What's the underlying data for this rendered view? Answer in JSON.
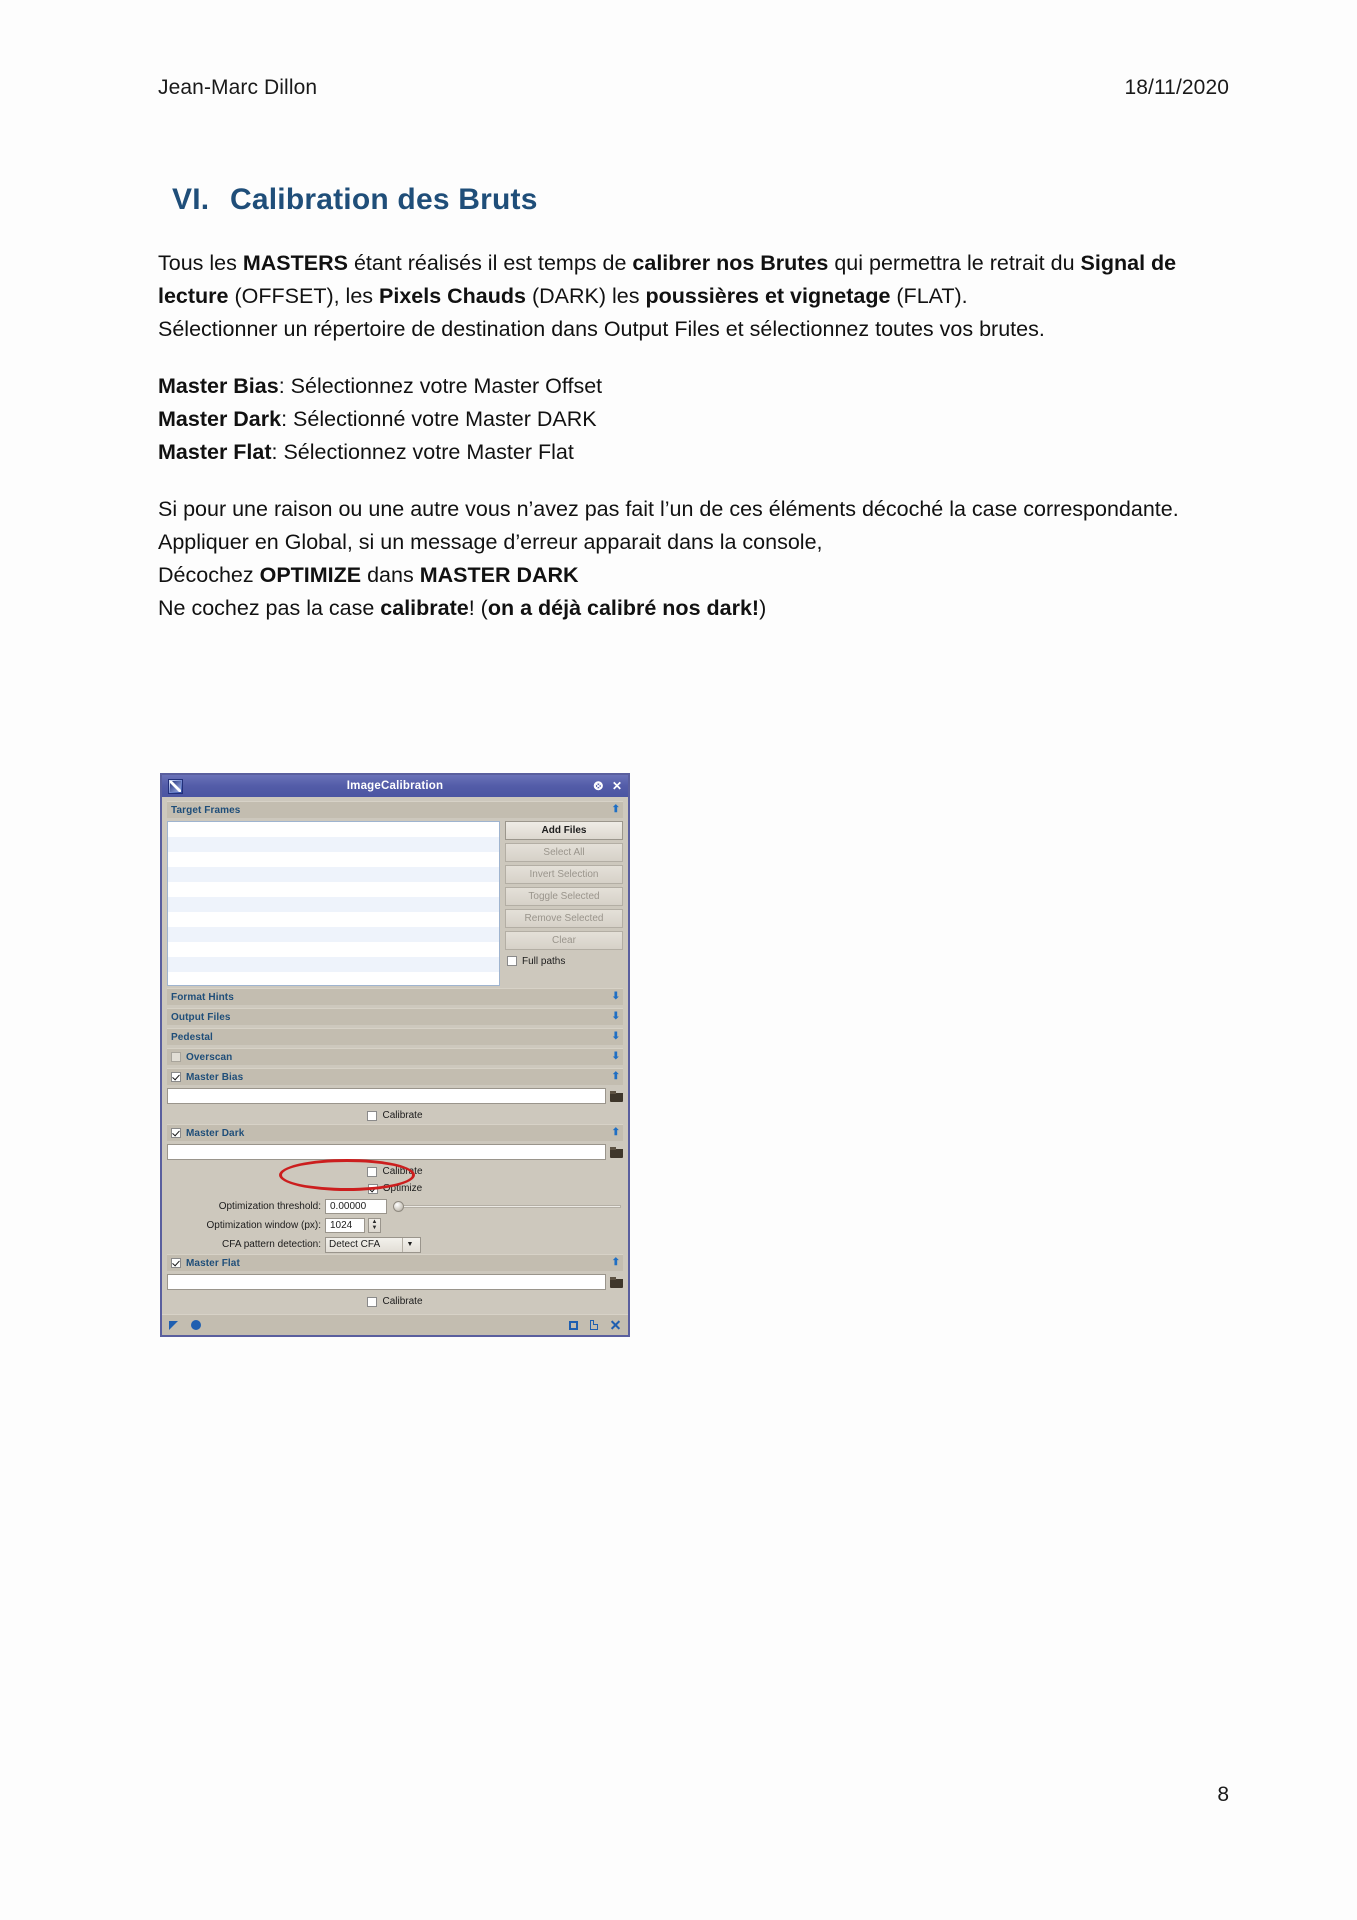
{
  "header": {
    "author": "Jean-Marc Dillon",
    "date": "18/11/2020"
  },
  "heading": {
    "numeral": "VI.",
    "title": "Calibration des Bruts"
  },
  "body": {
    "p1_a": "Tous les ",
    "p1_b1": "MASTERS",
    "p1_b": " étant réalisés il est temps de ",
    "p1_b2": "calibrer nos Brutes",
    "p1_c": " qui permettra le retrait du ",
    "p1_b3": "Signal de lecture",
    "p1_d": " (OFFSET), les ",
    "p1_b4": "Pixels Chauds",
    "p1_e": " (DARK) les ",
    "p1_b5": "poussières et vignetage",
    "p1_f": " (FLAT).",
    "p2": "Sélectionner un répertoire de destination dans Output Files et sélectionnez toutes vos brutes.",
    "m1_b": "Master Bias",
    "m1_t": ": Sélectionnez votre Master Offset",
    "m2_b": "Master Dark",
    "m2_t": ": Sélectionné votre Master DARK",
    "m3_b": "Master Flat",
    "m3_t": ": Sélectionnez votre Master Flat",
    "p3": "Si pour une raison ou une autre vous n’avez pas fait l’un de ces éléments décoché la case correspondante.",
    "p4": "Appliquer en Global, si un message d’erreur apparait dans la console,",
    "p5_a": "Décochez ",
    "p5_b1": "OPTIMIZE",
    "p5_b": " dans ",
    "p5_b2": "MASTER DARK",
    "p6_a": "Ne cochez pas la case ",
    "p6_b1": "calibrate",
    "p6_b": "! (",
    "p6_b2": "on a déjà calibré nos dark!",
    "p6_c": ")"
  },
  "dialog": {
    "title": "ImageCalibration",
    "titlebar_buttons": {
      "pin": "✕",
      "pin_icon": "⧉",
      "collapse": "⨷",
      "close": "✕"
    },
    "target_frames": {
      "label": "Target Frames",
      "collapse_glyph": "⬆",
      "buttons": [
        {
          "label": "Add Files",
          "enabled": true
        },
        {
          "label": "Select All",
          "enabled": false
        },
        {
          "label": "Invert Selection",
          "enabled": false
        },
        {
          "label": "Toggle Selected",
          "enabled": false
        },
        {
          "label": "Remove Selected",
          "enabled": false
        },
        {
          "label": "Clear",
          "enabled": false
        }
      ],
      "full_paths_label": "Full paths",
      "full_paths_checked": false
    },
    "sections": [
      {
        "label": "Format Hints",
        "expanded": false,
        "glyph": "⬇"
      },
      {
        "label": "Output Files",
        "expanded": false,
        "glyph": "⬇"
      },
      {
        "label": "Pedestal",
        "expanded": false,
        "glyph": "⬇"
      },
      {
        "label": "Overscan",
        "expanded": false,
        "glyph": "⬇",
        "checkbox": false
      }
    ],
    "master_bias": {
      "label": "Master Bias",
      "checked": true,
      "collapse_glyph": "⬆",
      "path": "",
      "calibrate_label": "Calibrate",
      "calibrate_checked": false
    },
    "master_dark": {
      "label": "Master Dark",
      "checked": true,
      "collapse_glyph": "⬆",
      "path": "",
      "calibrate_label": "Calibrate",
      "calibrate_checked": false,
      "optimize_label": "Optimize",
      "optimize_checked": true,
      "threshold_label": "Optimization threshold:",
      "threshold_value": "0.00000",
      "window_label": "Optimization window (px):",
      "window_value": "1024",
      "cfa_label": "CFA pattern detection:",
      "cfa_value": "Detect CFA"
    },
    "master_flat": {
      "label": "Master Flat",
      "checked": true,
      "collapse_glyph": "⬆",
      "path": "",
      "calibrate_label": "Calibrate",
      "calibrate_checked": false
    },
    "footer_icons": [
      "apply-triangle-icon",
      "apply-global-circle-icon",
      "new-instance-square-icon",
      "browse-documentation-icon",
      "reset-icon"
    ]
  },
  "annotation": {
    "ellipse_color": "#cc1e1e",
    "target": "optimize-checkbox"
  },
  "footer": {
    "page_number": "8"
  },
  "colors": {
    "heading": "#1f4e79",
    "titlebar": "#535ca8",
    "dialog_bg": "#cdc8bd",
    "section_bg": "#c3bdb0",
    "accent_blue": "#1f6fc4"
  }
}
